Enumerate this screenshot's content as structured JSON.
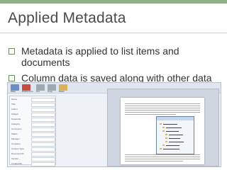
{
  "slide": {
    "title": "Applied Metadata",
    "bullets": [
      "Metadata is applied to list items and documents",
      "Column data is saved along with other data"
    ]
  },
  "colors": {
    "accent": "#8fb08a",
    "title_text": "#4a4a4a",
    "bullet_box": "#6b8e62"
  },
  "screenshot": {
    "ribbon_buttons": [
      "Save",
      "Delete Item",
      "Cut",
      "Copy",
      "Paste"
    ],
    "property_fields": [
      "Name",
      "Title",
      "Author",
      "Subject",
      "Keywords",
      "Category",
      "Comments",
      "Status",
      "Manager",
      "Company",
      "Content Type",
      "Document ID",
      "Version",
      "Created By"
    ]
  }
}
